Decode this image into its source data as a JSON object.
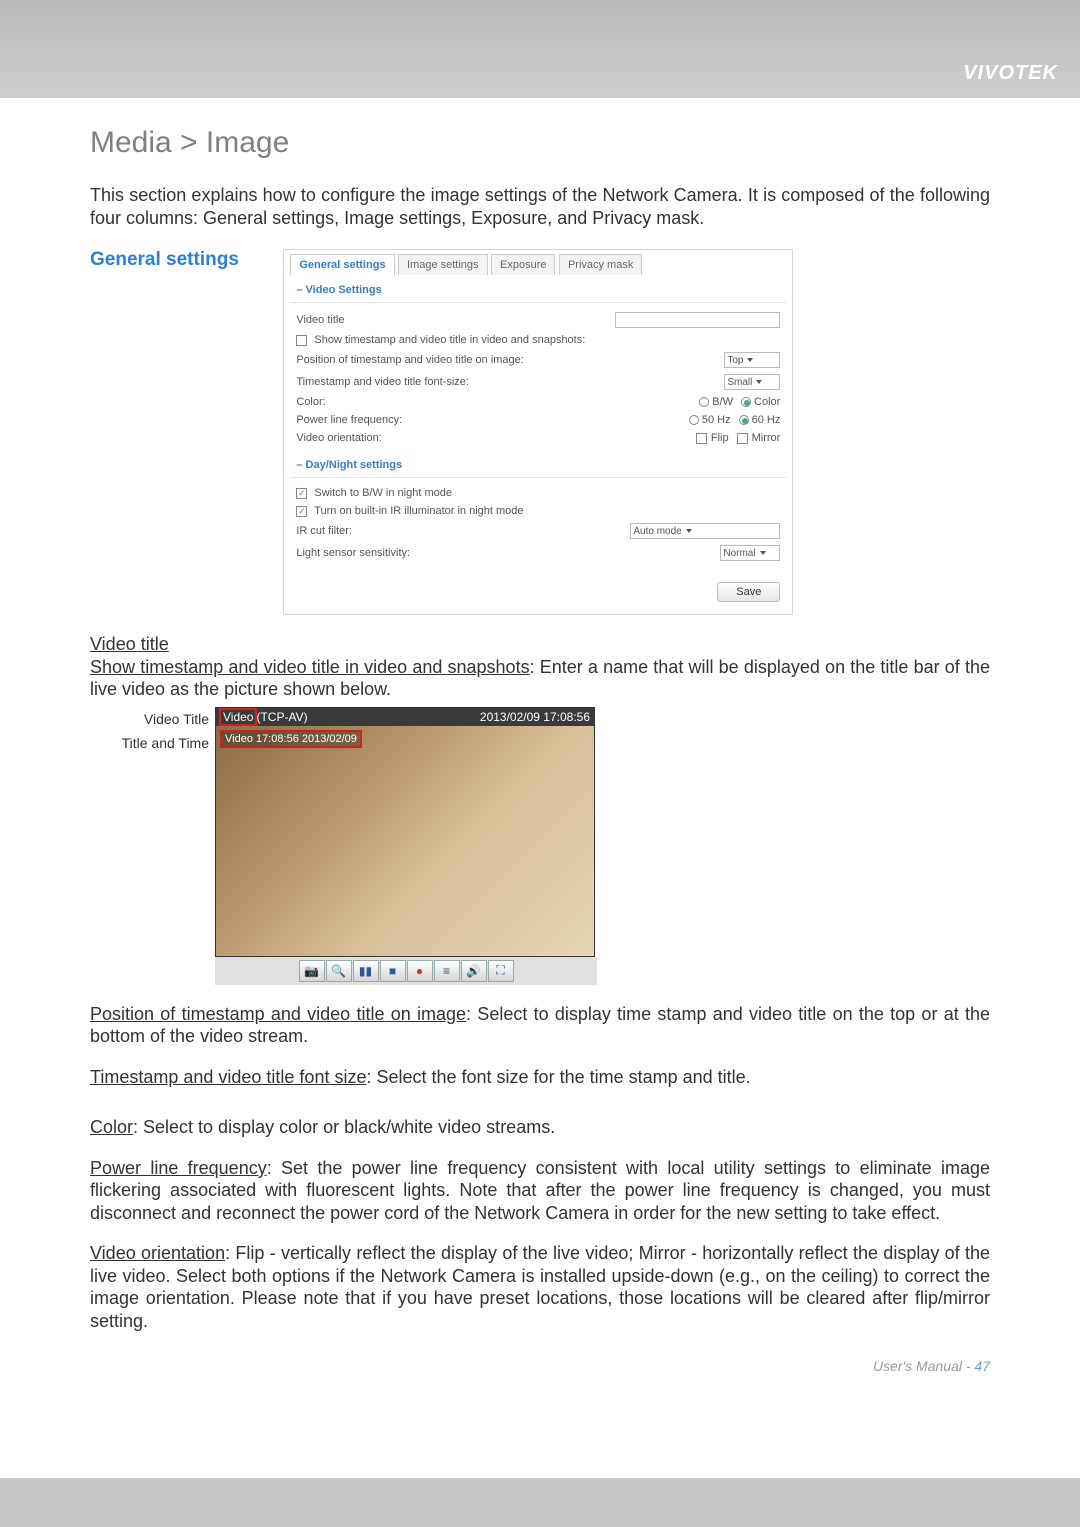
{
  "brand": "VIVOTEK",
  "section_title": "Media > Image",
  "intro": "This section explains how to configure the image settings of the Network Camera. It is composed of the following four columns: General settings, Image settings, Exposure, and Privacy mask.",
  "subhead": "General settings",
  "tabs": [
    "General settings",
    "Image settings",
    "Exposure",
    "Privacy mask"
  ],
  "panel": {
    "videoSettings": {
      "title": "Video Settings",
      "videoTitleLabel": "Video title",
      "showTimestampLabel": "Show timestamp and video title in video and snapshots:",
      "positionLabel": "Position of timestamp and video title on image:",
      "positionValue": "Top",
      "fontLabel": "Timestamp and video title font-size:",
      "fontValue": "Small",
      "colorLabel": "Color:",
      "colorOptions": [
        "B/W",
        "Color"
      ],
      "powerLabel": "Power line frequency:",
      "powerOptions": [
        "50 Hz",
        "60 Hz"
      ],
      "orientLabel": "Video orientation:",
      "orientOptions": [
        "Flip",
        "Mirror"
      ]
    },
    "dayNight": {
      "title": "Day/Night settings",
      "switchBW": "Switch to B/W in night mode",
      "builtInIR": "Turn on built-in IR illuminator in night mode",
      "irCutLabel": "IR cut filter:",
      "irCutValue": "Auto mode",
      "lightSensorLabel": "Light sensor sensitivity:",
      "lightSensorValue": "Normal"
    },
    "save": "Save"
  },
  "videoTitleFig": {
    "line1Label": "Video Title",
    "line2Label": "Title and Time",
    "topLeft": "Video",
    "topLeftExtra": "(TCP-AV)",
    "topRight": "2013/02/09 17:08:56",
    "overlayText": "Video 17:08:56 2013/02/09",
    "toolbarIcons": [
      "camera-icon",
      "zoom-icon",
      "pause-icon",
      "stop-icon",
      "record-icon",
      "playlist-icon",
      "volume-icon",
      "fullscreen-icon"
    ]
  },
  "body": {
    "vt_heading": "Video title",
    "vt_para_u": "Show timestamp and video title in video and snapshots",
    "vt_para_rest": ": Enter a name that will be displayed on the title bar of the live video as the picture shown below.",
    "pos_u": "Position of timestamp and video title on image",
    "pos_rest": ": Select to display time stamp and video title on the top or at the bottom of the video stream.",
    "font_u": "Timestamp and video title font size",
    "font_rest": ": Select the font size for the time stamp and title.",
    "color_u": "Color",
    "color_rest": ": Select to display color or black/white video streams.",
    "power_u": "Power line frequency",
    "power_rest": ": Set the power line frequency consistent with local utility settings to eliminate image flickering associated with fluorescent lights. Note that after the power line frequency is changed, you must disconnect and reconnect the power cord of the Network Camera in order for the new setting to take effect.",
    "orient_u": "Video orientation",
    "orient_rest": ": Flip - vertically reflect the display of the live video; Mirror - horizontally reflect the display of the live video. Select both options if the Network Camera is installed upside-down (e.g., on the ceiling) to correct the image orientation. Please note that if you have preset locations, those locations will be cleared after flip/mirror setting."
  },
  "footer": {
    "text": "User's Manual - ",
    "page": "47"
  }
}
